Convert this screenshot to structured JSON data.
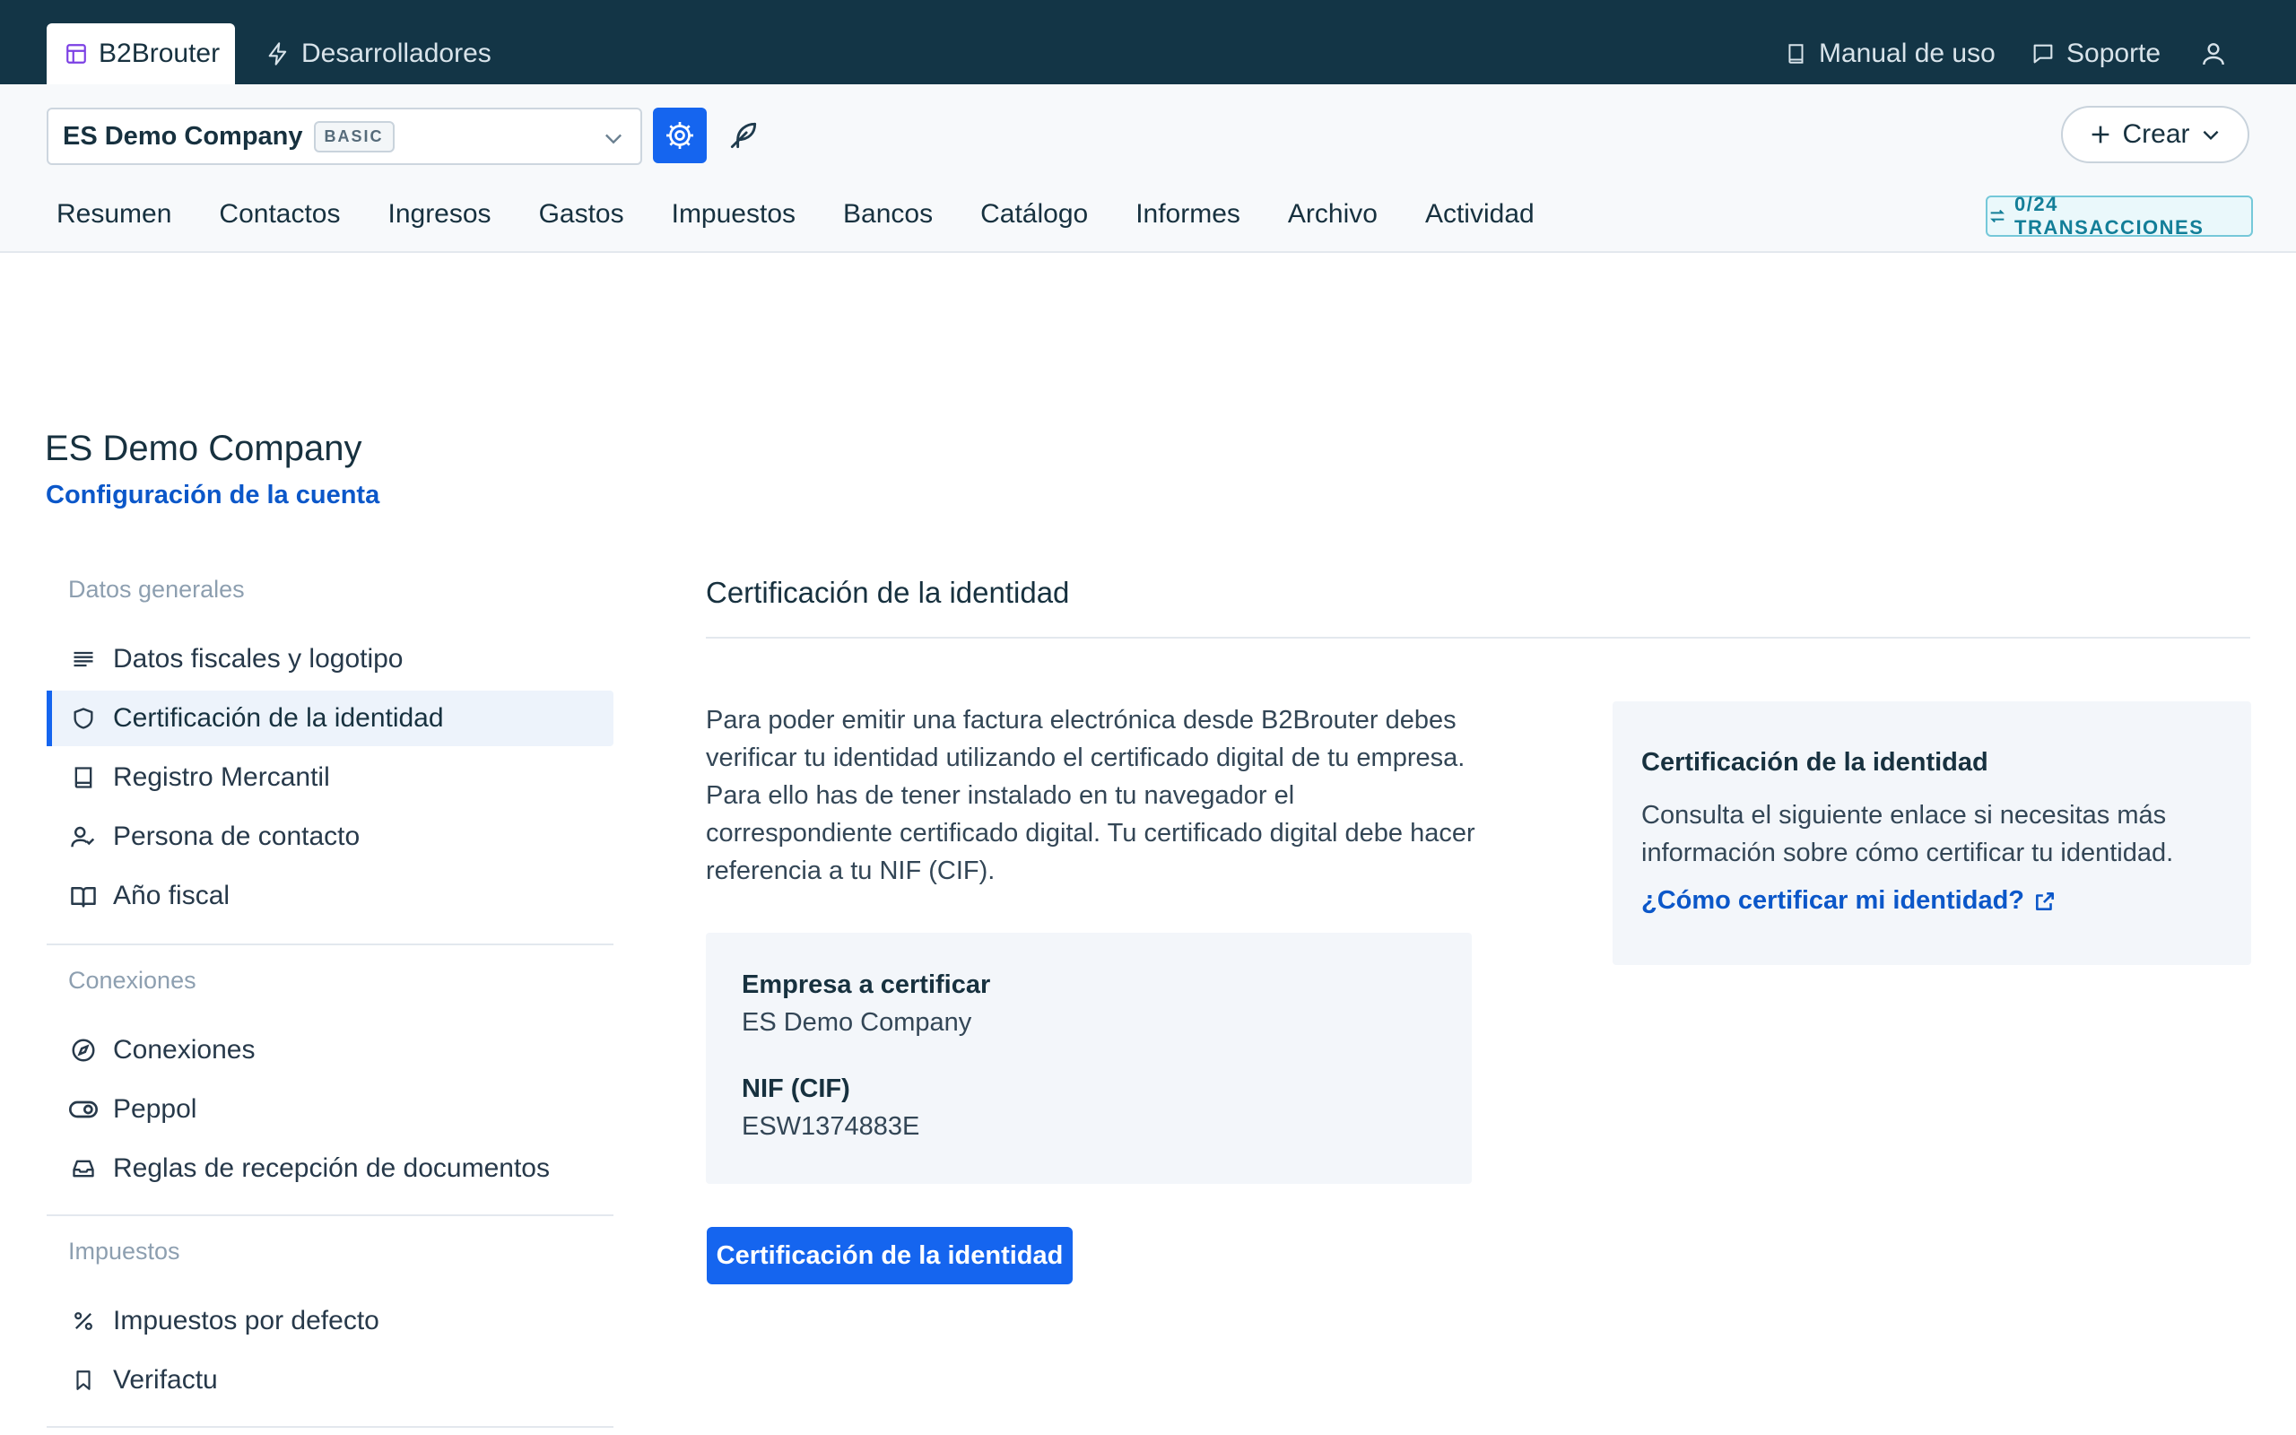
{
  "topbar": {
    "app_tab": "B2Brouter",
    "dev_tab": "Desarrolladores",
    "manual": "Manual de uso",
    "support": "Soporte"
  },
  "company_bar": {
    "company": "ES Demo Company",
    "plan": "BASIC",
    "create": "Crear"
  },
  "nav": {
    "items": [
      "Resumen",
      "Contactos",
      "Ingresos",
      "Gastos",
      "Impuestos",
      "Bancos",
      "Catálogo",
      "Informes",
      "Archivo",
      "Actividad"
    ],
    "transactions": "0/24 TRANSACCIONES"
  },
  "page": {
    "title": "ES Demo Company",
    "subtitle": "Configuración de la cuenta"
  },
  "sidebar": {
    "sections": [
      {
        "title": "Datos generales"
      },
      {
        "title": "Conexiones"
      },
      {
        "title": "Impuestos"
      }
    ],
    "items": [
      {
        "label": "Datos fiscales y logotipo",
        "icon": "text-lines-icon"
      },
      {
        "label": "Certificación de la identidad",
        "icon": "shield-icon"
      },
      {
        "label": "Registro Mercantil",
        "icon": "book-icon"
      },
      {
        "label": "Persona de contacto",
        "icon": "user-check-icon"
      },
      {
        "label": "Año fiscal",
        "icon": "open-book-icon"
      },
      {
        "label": "Conexiones",
        "icon": "compass-icon"
      },
      {
        "label": "Peppol",
        "icon": "toggle-icon"
      },
      {
        "label": "Reglas de recepción de documentos",
        "icon": "inbox-icon"
      },
      {
        "label": "Impuestos por defecto",
        "icon": "percent-icon"
      },
      {
        "label": "Verifactu",
        "icon": "bookmark-icon"
      }
    ]
  },
  "content": {
    "heading": "Certificación de la identidad",
    "paragraph": "Para poder emitir una factura electrónica desde B2Brouter debes verificar tu identidad utilizando el certificado digital de tu empresa. Para ello has de tener instalado en tu navegador el correspondiente certificado digital. Tu certificado digital debe hacer referencia a tu NIF (CIF).",
    "company_label": "Empresa a certificar",
    "company_value": "ES Demo Company",
    "nif_label": "NIF (CIF)",
    "nif_value": "ESW1374883E",
    "button": "Certificación de la identidad"
  },
  "help": {
    "title": "Certificación de la identidad",
    "text": "Consulta el siguiente enlace si necesitas más información sobre cómo certificar tu identidad.",
    "link": "¿Cómo certificar mi identidad?"
  },
  "colors": {
    "topbar": "#133546",
    "accent": "#1565ef",
    "link": "#0b57c9"
  }
}
